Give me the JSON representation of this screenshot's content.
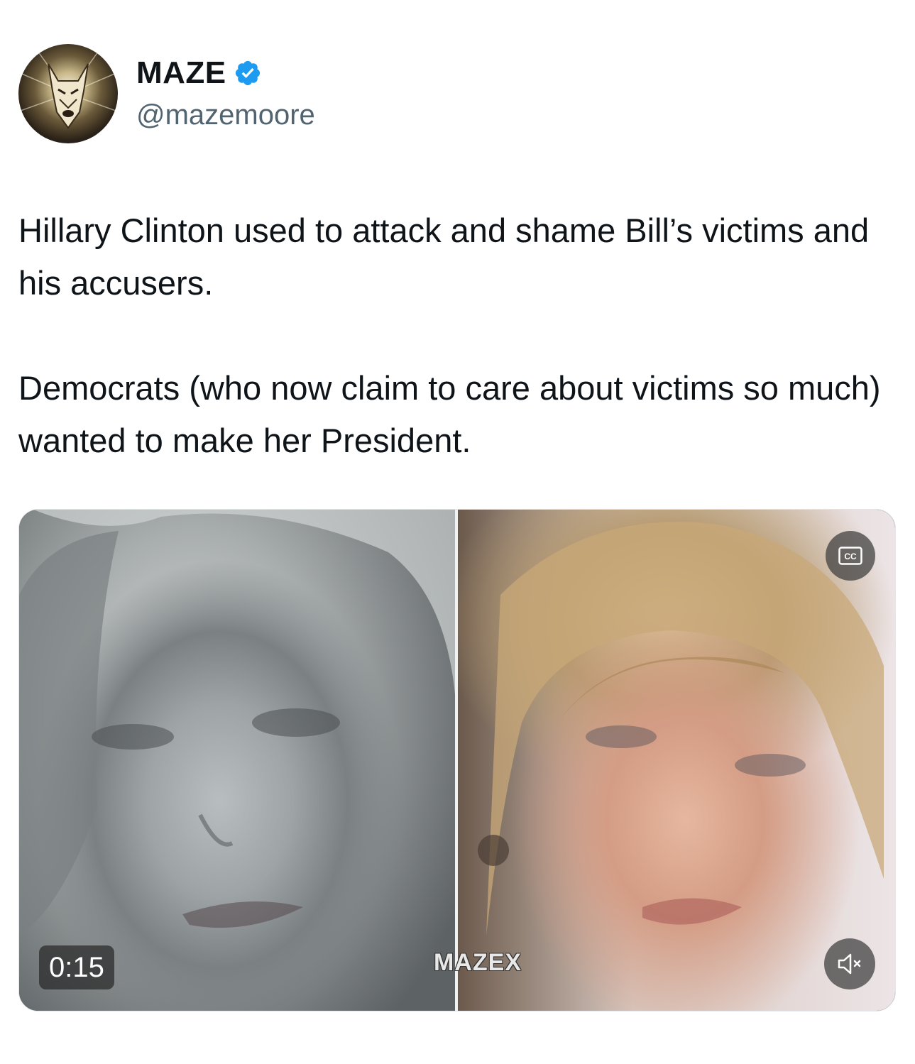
{
  "author": {
    "display_name": "MAZE",
    "handle": "@mazemoore",
    "verified": true,
    "avatar_icon": "doberman-logo-icon"
  },
  "tweet": {
    "paragraphs": [
      "Hillary Clinton used to attack and shame Bill’s victims and his accusers.",
      "Democrats (who now claim to care about victims so much) wanted to make her President."
    ]
  },
  "media": {
    "duration": "0:15",
    "watermark": "MAZE",
    "watermark_suffix": "X",
    "cc_icon": "closed-captions-icon",
    "mute_icon": "speaker-muted-icon"
  },
  "colors": {
    "verified_badge": "#1d9bf0",
    "text_primary": "#0f1419",
    "text_secondary": "#536471"
  }
}
